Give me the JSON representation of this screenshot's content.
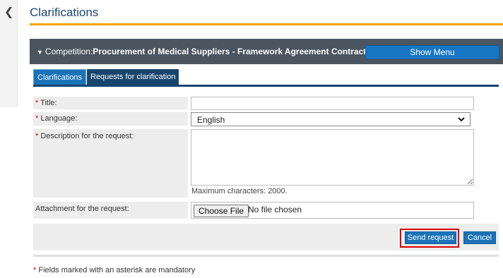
{
  "page": {
    "title": "Clarifications"
  },
  "competition": {
    "prefix": "Competition:",
    "name": "Procurement of Medical Suppliers - Framework Agreement Contract",
    "show_menu_label": "Show Menu"
  },
  "tabs": [
    {
      "label": "Clarifications",
      "active": true
    },
    {
      "label": "Requests for clarification",
      "active": false
    }
  ],
  "form": {
    "required_marker": "*",
    "title_label": "Title:",
    "title_value": "",
    "language_label": "Language:",
    "language_value": "English",
    "description_label": "Description for the request:",
    "description_value": "",
    "max_chars_note": "Maximum characters: 2000.",
    "attachment_label": "Attachment for the request:",
    "choose_file_label": "Choose File",
    "no_file_text": "No file chosen"
  },
  "actions": {
    "send_label": "Send request",
    "cancel_label": "Cancel"
  },
  "footer": {
    "mandatory_note": "Fields marked with an asterisk are mandatory"
  },
  "colors": {
    "title_blue": "#17456e",
    "accent_orange": "#f5a300",
    "button_blue": "#1a73b8",
    "bar_gray": "#4a5560",
    "highlight_red": "#d40000",
    "required_red": "#cc0000"
  }
}
